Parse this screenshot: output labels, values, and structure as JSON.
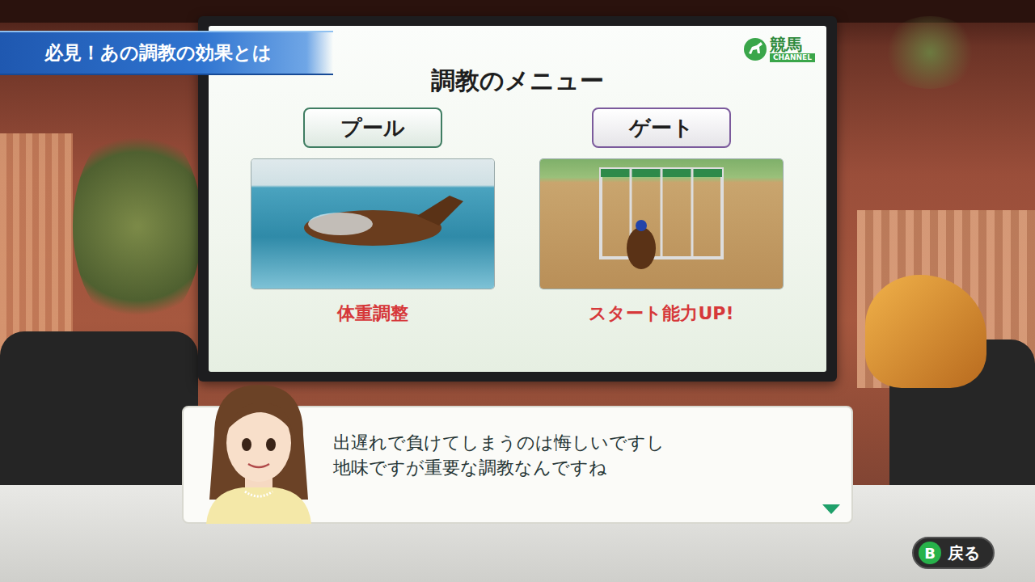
{
  "banner": {
    "title": "必見！あの調教の効果とは"
  },
  "logo": {
    "text": "競馬",
    "sub": "CHANNEL"
  },
  "board": {
    "title": "調教のメニュー",
    "items": [
      {
        "label": "プール",
        "effect": "体重調整",
        "color": "#3f7d62",
        "kind": "pool"
      },
      {
        "label": "ゲート",
        "effect": "スタート能力UP!",
        "color": "#7b5a9c",
        "kind": "gate"
      }
    ]
  },
  "dialog": {
    "lines": [
      "出遅れで負けてしまうのは悔しいですし",
      "地味ですが重要な調教なんですね"
    ]
  },
  "footer": {
    "buttons": [
      {
        "key": "B",
        "label": "戻る"
      }
    ]
  }
}
